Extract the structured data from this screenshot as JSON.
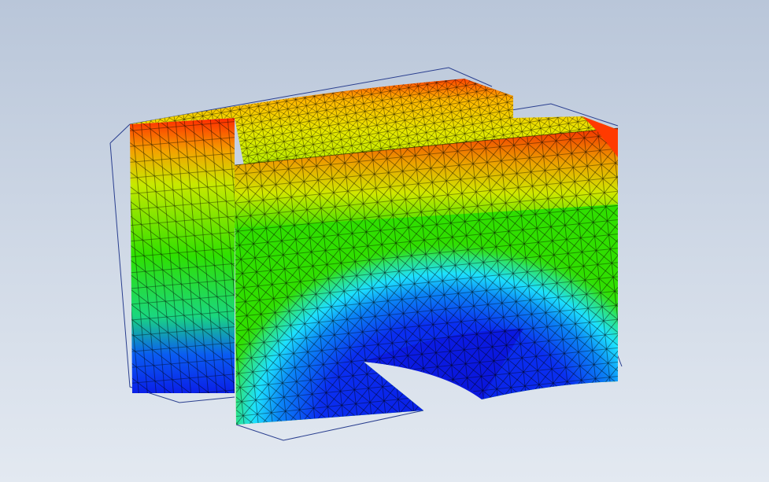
{
  "viewport": {
    "background_top": "#b9c6d9",
    "background_bottom": "#e3e9f1"
  },
  "model": {
    "kind": "fea-mesh-deformation-plot",
    "colormap": [
      "#0016e0",
      "#1fd7ff",
      "#2ee000",
      "#f1e600",
      "#ff2100"
    ],
    "mesh_line_color": "#000000",
    "undeformed_outline_color": "#2a3f8f"
  }
}
